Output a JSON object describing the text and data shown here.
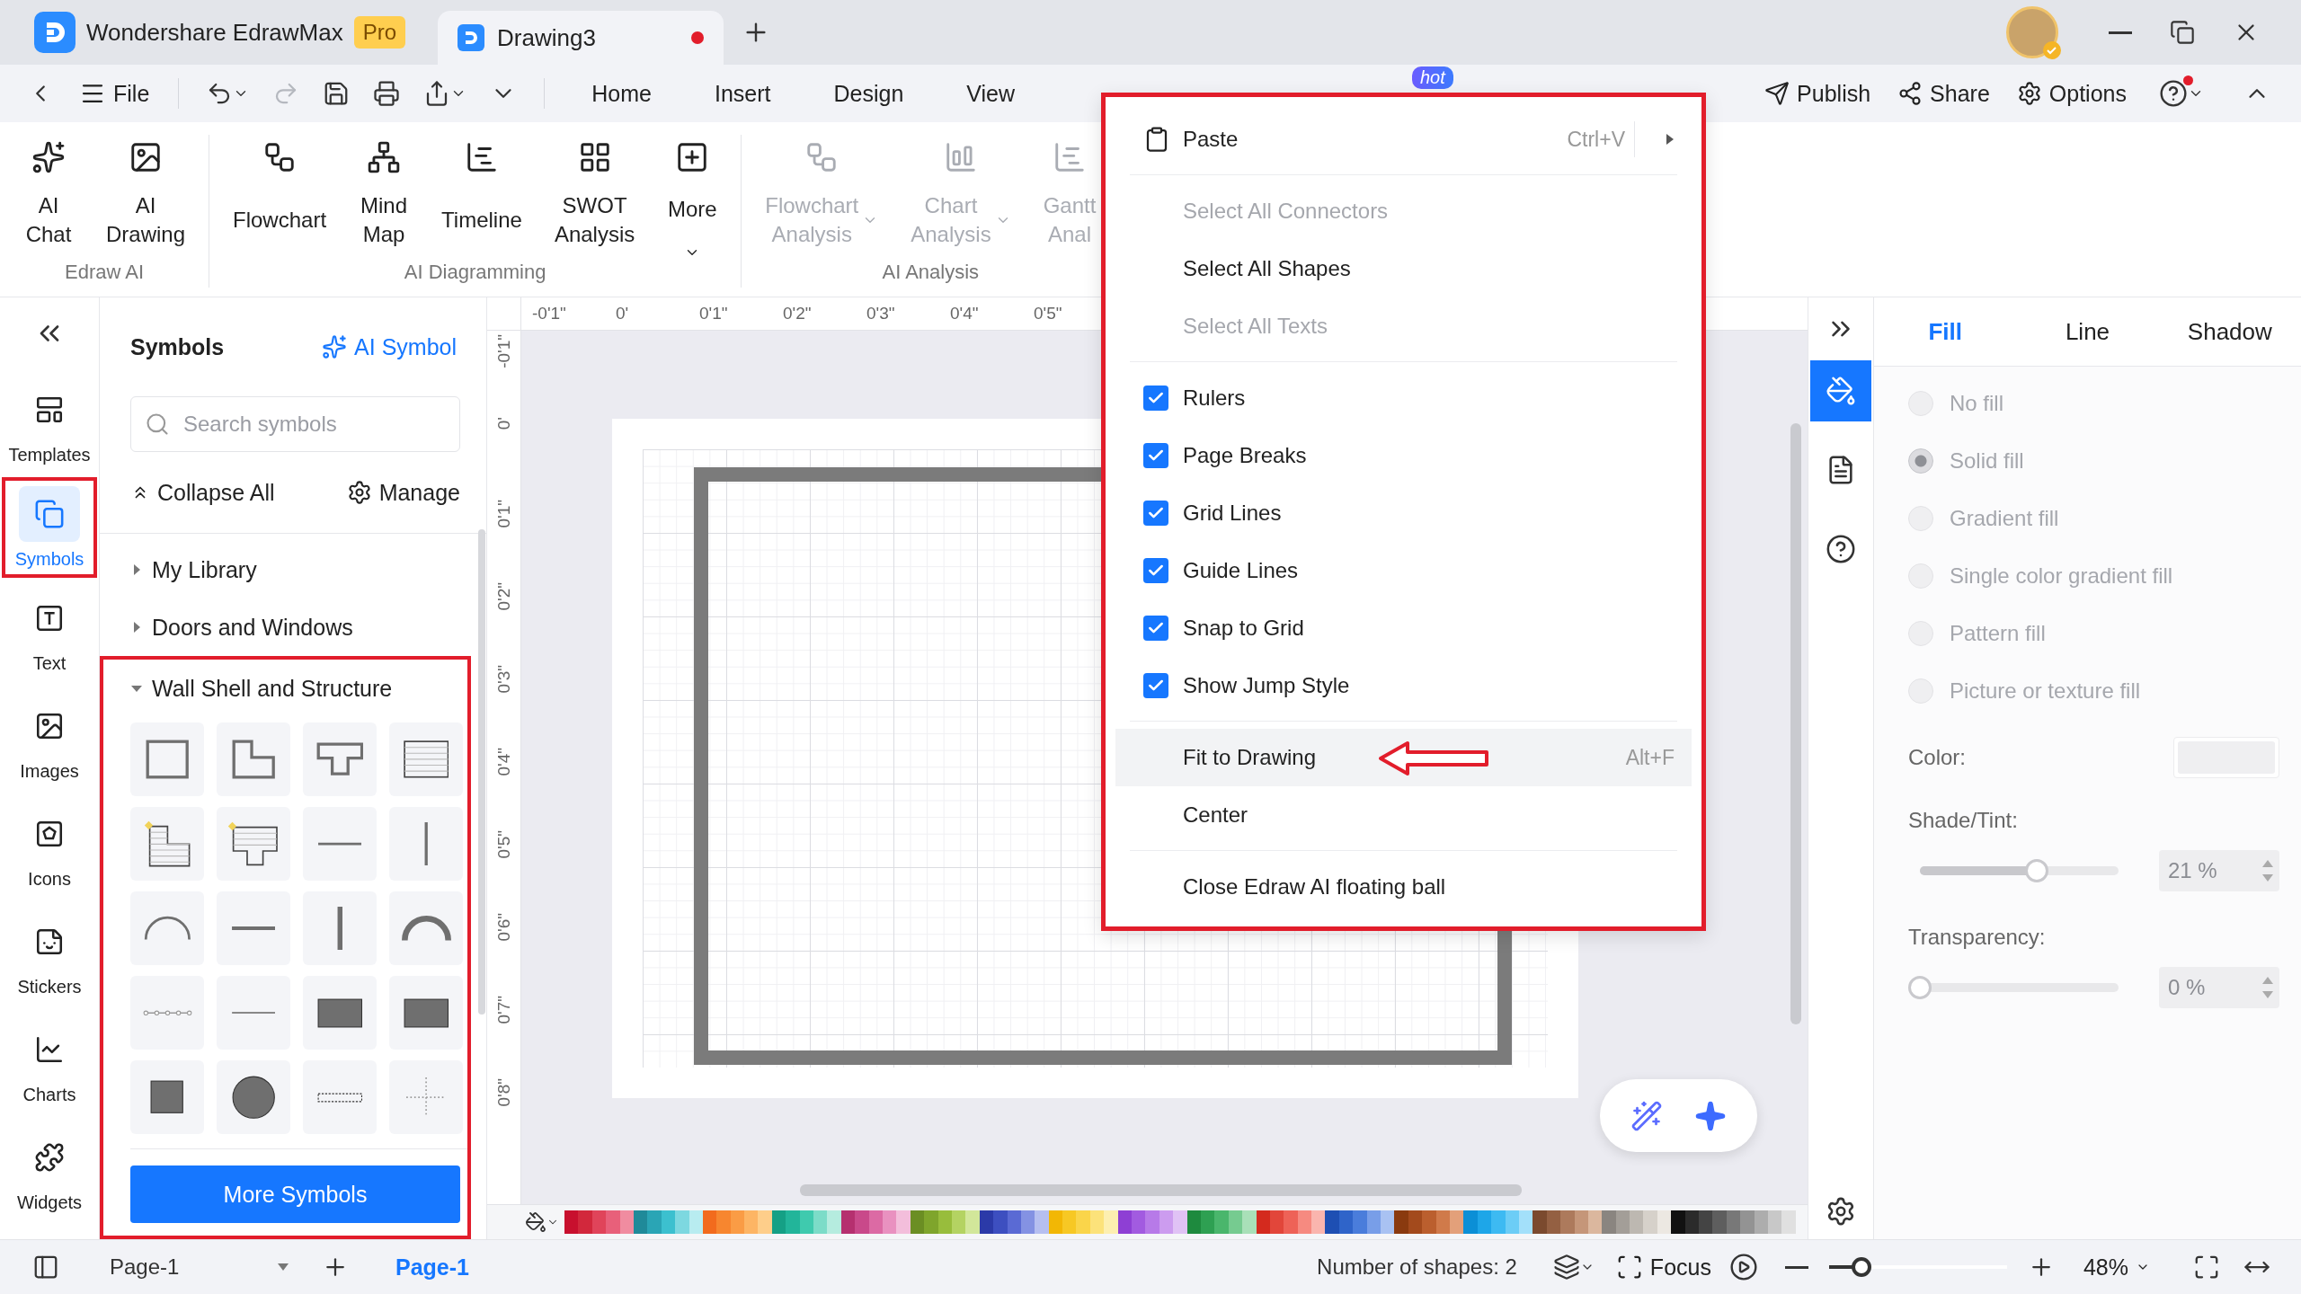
{
  "title_bar": {
    "app_name": "Wondershare EdrawMax",
    "plan_badge": "Pro",
    "tabs": [
      {
        "label": "Drawing3",
        "selected": true,
        "unsaved": true
      }
    ]
  },
  "menu_bar": {
    "quick_tools": [
      {
        "kind": "back",
        "disabled": false
      },
      {
        "kind": "file",
        "label": "File",
        "disabled": false
      },
      {
        "kind": "undo",
        "disabled": false,
        "dropdown": true
      },
      {
        "kind": "redo",
        "disabled": true
      },
      {
        "kind": "save",
        "disabled": false
      },
      {
        "kind": "print",
        "disabled": false
      },
      {
        "kind": "export",
        "disabled": false,
        "dropdown": true
      },
      {
        "kind": "customize",
        "disabled": false
      }
    ],
    "tabs": [
      {
        "label": "Home",
        "selected": false
      },
      {
        "label": "Insert",
        "selected": false
      },
      {
        "label": "Design",
        "selected": false
      },
      {
        "label": "View",
        "selected": false
      }
    ],
    "hot_badge": "hot",
    "actions": [
      {
        "kind": "publish",
        "label": "Publish"
      },
      {
        "kind": "share",
        "label": "Share"
      },
      {
        "kind": "options",
        "label": "Options"
      },
      {
        "kind": "help",
        "notification": true
      },
      {
        "kind": "collapse"
      }
    ]
  },
  "ribbon": {
    "groups": [
      {
        "label": "Edraw AI",
        "items": [
          {
            "kind": "ai_chat",
            "label": "AI Chat",
            "disabled": false
          },
          {
            "kind": "ai_drawing",
            "label": "AI Drawing",
            "disabled": false
          }
        ]
      },
      {
        "label": "AI Diagramming",
        "items": [
          {
            "kind": "flowchart",
            "label": "Flowchart",
            "disabled": false
          },
          {
            "kind": "mind_map",
            "label": "Mind Map",
            "disabled": false
          },
          {
            "kind": "timeline",
            "label": "Timeline",
            "disabled": false
          },
          {
            "kind": "swot",
            "label": "SWOT Analysis",
            "disabled": false
          },
          {
            "kind": "more",
            "label": "More",
            "disabled": false,
            "dropdown": true
          }
        ]
      },
      {
        "label": "AI Analysis",
        "items": [
          {
            "kind": "flowchart_analysis",
            "label": "Flowchart Analysis",
            "disabled": true,
            "dropdown": true
          },
          {
            "kind": "chart_analysis",
            "label": "Chart Analysis",
            "disabled": true,
            "dropdown": true
          },
          {
            "kind": "gantt",
            "label": "Gantt Anal",
            "disabled": true
          }
        ]
      }
    ]
  },
  "left_rail": {
    "items": [
      {
        "kind": "templates",
        "label": "Templates",
        "selected": false
      },
      {
        "kind": "symbols",
        "label": "Symbols",
        "selected": true
      },
      {
        "kind": "text",
        "label": "Text",
        "selected": false
      },
      {
        "kind": "images",
        "label": "Images",
        "selected": false
      },
      {
        "kind": "icons",
        "label": "Icons",
        "selected": false
      },
      {
        "kind": "stickers",
        "label": "Stickers",
        "selected": false
      },
      {
        "kind": "charts",
        "label": "Charts",
        "selected": false
      },
      {
        "kind": "widgets",
        "label": "Widgets",
        "selected": false
      }
    ]
  },
  "symbols_panel": {
    "title": "Symbols",
    "ai_link": "AI Symbol",
    "search": {
      "placeholder": "Search symbols"
    },
    "collapse_all": "Collapse All",
    "manage": "Manage",
    "libraries": [
      {
        "label": "My Library",
        "expanded": false
      },
      {
        "label": "Doors and Windows",
        "expanded": false
      },
      {
        "label": "Wall Shell and Structure",
        "expanded": true,
        "symbols": [
          {
            "kind": "room"
          },
          {
            "kind": "l_room"
          },
          {
            "kind": "t_room"
          },
          {
            "kind": "floor_lines"
          },
          {
            "kind": "l_floor"
          },
          {
            "kind": "step_floor"
          },
          {
            "kind": "h_wall"
          },
          {
            "kind": "v_wall"
          },
          {
            "kind": "arc_thin"
          },
          {
            "kind": "h_wall_thick"
          },
          {
            "kind": "v_wall_thick"
          },
          {
            "kind": "arc_thick"
          },
          {
            "kind": "dotted_wall"
          },
          {
            "kind": "h_line"
          },
          {
            "kind": "rect_fill"
          },
          {
            "kind": "rect_fill"
          },
          {
            "kind": "square_fill"
          },
          {
            "kind": "circle_fill"
          },
          {
            "kind": "dashed_bar"
          },
          {
            "kind": "cross_dots"
          }
        ]
      }
    ],
    "more_button": "More Symbols"
  },
  "canvas": {
    "rulers": {
      "horizontal": [
        "-0'1\"",
        "0'",
        "0'1\"",
        "0'2\"",
        "0'3\"",
        "0'4\"",
        "0'5\""
      ],
      "vertical": [
        "-0'1\"",
        "0'",
        "0'1\"",
        "0'2\"",
        "0'3\"",
        "0'4\"",
        "0'5\"",
        "0'6\"",
        "0'7\"",
        "0'8\""
      ]
    },
    "palette": [
      {
        "color": "#c8102e"
      },
      {
        "color": "#d2283c"
      },
      {
        "color": "#e0445a"
      },
      {
        "color": "#e8607a"
      },
      {
        "color": "#f08ca0"
      },
      {
        "color": "#1f8a99"
      },
      {
        "color": "#2aa5b5"
      },
      {
        "color": "#3cc0cf"
      },
      {
        "color": "#7dd8e0"
      },
      {
        "color": "#b8ecf0"
      },
      {
        "color": "#f26b1d"
      },
      {
        "color": "#f7862f"
      },
      {
        "color": "#fa9c45"
      },
      {
        "color": "#fdb564"
      },
      {
        "color": "#fece8a"
      },
      {
        "color": "#15a085"
      },
      {
        "color": "#22b59a"
      },
      {
        "color": "#3fcaae"
      },
      {
        "color": "#7cdcc8"
      },
      {
        "color": "#b5ecdf"
      },
      {
        "color": "#b5306f"
      },
      {
        "color": "#c9498a"
      },
      {
        "color": "#dc6aa4"
      },
      {
        "color": "#e991c0"
      },
      {
        "color": "#f3bedb"
      },
      {
        "color": "#6b8e23"
      },
      {
        "color": "#7fa52c"
      },
      {
        "color": "#98bd3c"
      },
      {
        "color": "#b4d362"
      },
      {
        "color": "#d2e79a"
      },
      {
        "color": "#2b3aa8"
      },
      {
        "color": "#3d4fc0"
      },
      {
        "color": "#5a6ad4"
      },
      {
        "color": "#8492e3"
      },
      {
        "color": "#b6bff0"
      },
      {
        "color": "#f2b705"
      },
      {
        "color": "#f7c824"
      },
      {
        "color": "#fad54a"
      },
      {
        "color": "#fce27a"
      },
      {
        "color": "#fdefb0"
      },
      {
        "color": "#8e3fd4"
      },
      {
        "color": "#a25be0"
      },
      {
        "color": "#b77ae8"
      },
      {
        "color": "#cc9cef"
      },
      {
        "color": "#e0c2f5"
      },
      {
        "color": "#1e8a3e"
      },
      {
        "color": "#2ea052"
      },
      {
        "color": "#4ab66c"
      },
      {
        "color": "#76cb90"
      },
      {
        "color": "#a9e0b8"
      },
      {
        "color": "#d42a1e"
      },
      {
        "color": "#e2463a"
      },
      {
        "color": "#ee6257"
      },
      {
        "color": "#f68a80"
      },
      {
        "color": "#fab5ae"
      },
      {
        "color": "#1e4fb3"
      },
      {
        "color": "#2f64c9"
      },
      {
        "color": "#4a7ddb"
      },
      {
        "color": "#789ee8"
      },
      {
        "color": "#a9c2f2"
      },
      {
        "color": "#8a3a0f"
      },
      {
        "color": "#a34a1c"
      },
      {
        "color": "#bb5f2e"
      },
      {
        "color": "#d07a4a"
      },
      {
        "color": "#e3a07a"
      },
      {
        "color": "#0b8fd6"
      },
      {
        "color": "#1ea6e8"
      },
      {
        "color": "#3dbaf2"
      },
      {
        "color": "#6ccdf6"
      },
      {
        "color": "#a3e0fa"
      },
      {
        "color": "#7b4a2e"
      },
      {
        "color": "#946042"
      },
      {
        "color": "#ad7a5c"
      },
      {
        "color": "#c59679"
      },
      {
        "color": "#dbb79e"
      },
      {
        "color": "#8a8580"
      },
      {
        "color": "#a39e98"
      },
      {
        "color": "#bdb8b1"
      },
      {
        "color": "#d6d1ca"
      },
      {
        "color": "#ece8e2"
      },
      {
        "color": "#111111"
      },
      {
        "color": "#2b2b2b"
      },
      {
        "color": "#444444"
      },
      {
        "color": "#5e5e5e"
      },
      {
        "color": "#787878"
      },
      {
        "color": "#939393"
      },
      {
        "color": "#adadad"
      },
      {
        "color": "#c8c8c8"
      },
      {
        "color": "#e0e0e0"
      }
    ]
  },
  "context_menu": {
    "items": [
      {
        "kind": "paste",
        "label": "Paste",
        "shortcut": "Ctrl+V",
        "submenu": true,
        "disabled": false,
        "selected": false
      },
      {
        "kind": "separator"
      },
      {
        "kind": "command",
        "label": "Select All Connectors",
        "disabled": true,
        "selected": false
      },
      {
        "kind": "command",
        "label": "Select All Shapes",
        "disabled": false,
        "selected": false
      },
      {
        "kind": "command",
        "label": "Select All Texts",
        "disabled": true,
        "selected": false
      },
      {
        "kind": "separator"
      },
      {
        "kind": "check",
        "label": "Rulers",
        "checked": true,
        "selected": false
      },
      {
        "kind": "check",
        "label": "Page Breaks",
        "checked": true,
        "selected": false
      },
      {
        "kind": "check",
        "label": "Grid Lines",
        "checked": true,
        "selected": false
      },
      {
        "kind": "check",
        "label": "Guide Lines",
        "checked": true,
        "selected": false
      },
      {
        "kind": "check",
        "label": "Snap to Grid",
        "checked": true,
        "selected": false
      },
      {
        "kind": "check",
        "label": "Show Jump Style",
        "checked": true,
        "selected": false
      },
      {
        "kind": "separator"
      },
      {
        "kind": "command",
        "label": "Fit to Drawing",
        "shortcut": "Alt+F",
        "disabled": false,
        "selected": true
      },
      {
        "kind": "command",
        "label": "Center",
        "disabled": false,
        "selected": false
      },
      {
        "kind": "separator"
      },
      {
        "kind": "command",
        "label": "Close Edraw AI floating ball",
        "disabled": false,
        "selected": false
      }
    ]
  },
  "right_rail": {
    "items": [
      {
        "kind": "fill",
        "selected": true
      },
      {
        "kind": "page",
        "selected": false
      },
      {
        "kind": "help",
        "selected": false
      }
    ]
  },
  "format_panel": {
    "tabs": [
      {
        "label": "Fill",
        "selected": true
      },
      {
        "label": "Line",
        "selected": false
      },
      {
        "label": "Shadow",
        "selected": false
      }
    ],
    "fill_options": [
      {
        "label": "No fill",
        "selected": false,
        "disabled": true
      },
      {
        "label": "Solid fill",
        "selected": true,
        "disabled": true
      },
      {
        "label": "Gradient fill",
        "selected": false,
        "disabled": true
      },
      {
        "label": "Single color gradient fill",
        "selected": false,
        "disabled": true
      },
      {
        "label": "Pattern fill",
        "selected": false,
        "disabled": true
      },
      {
        "label": "Picture or texture fill",
        "selected": false,
        "disabled": true
      }
    ],
    "color_label": "Color:",
    "sliders": [
      {
        "label": "Shade/Tint:",
        "level": 0.59,
        "value": "21 %"
      },
      {
        "label": "Transparency:",
        "level": 0,
        "value": "0 %"
      }
    ]
  },
  "status_bar": {
    "page_selector": "Page-1",
    "pages": [
      {
        "label": "Page-1",
        "selected": true
      }
    ],
    "shape_count": "Number of shapes: 2",
    "focus": "Focus",
    "zoom": {
      "level": 0.18,
      "value": "48%"
    }
  }
}
